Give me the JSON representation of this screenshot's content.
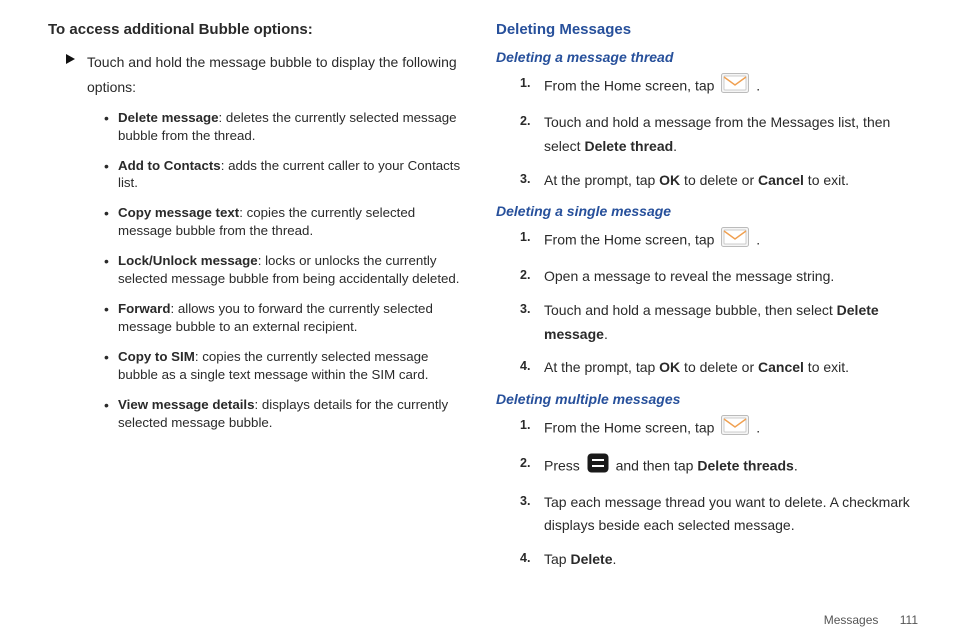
{
  "left": {
    "heading": "To access additional Bubble options:",
    "intro": "Touch and hold the message bubble to display the following options:",
    "bullets": [
      {
        "term": "Delete message",
        "desc": ": deletes the currently selected message bubble from the thread."
      },
      {
        "term": "Add to Contacts",
        "desc": ": adds the current caller to your Contacts list."
      },
      {
        "term": "Copy message text",
        "desc": ": copies the currently selected message bubble from the thread."
      },
      {
        "term": "Lock/Unlock message",
        "desc": ": locks or unlocks the currently selected message bubble from being accidentally deleted."
      },
      {
        "term": "Forward",
        "desc": ": allows you to forward the currently selected message bubble to an external recipient."
      },
      {
        "term": "Copy to SIM",
        "desc": ": copies the currently selected message bubble as a single text message within the SIM card."
      },
      {
        "term": "View message details",
        "desc": ": displays details for the currently selected message bubble."
      }
    ]
  },
  "right": {
    "heading": "Deleting Messages",
    "thread": {
      "title": "Deleting a message thread",
      "s1a": "From the Home screen, tap ",
      "s1b": ".",
      "s2a": "Touch and hold a message from the Messages list, then select ",
      "s2b": "Delete thread",
      "s2c": ".",
      "s3a": "At the prompt, tap ",
      "s3b": "OK",
      "s3c": " to delete or ",
      "s3d": "Cancel",
      "s3e": " to exit."
    },
    "single": {
      "title": "Deleting a single message",
      "s1a": "From the Home screen, tap ",
      "s1b": ".",
      "s2": "Open a message to reveal the message string.",
      "s3a": "Touch and hold a message bubble, then select ",
      "s3b": "Delete message",
      "s3c": ".",
      "s4a": "At the prompt, tap ",
      "s4b": "OK",
      "s4c": " to delete or ",
      "s4d": "Cancel",
      "s4e": " to exit."
    },
    "multiple": {
      "title": "Deleting multiple messages",
      "s1a": "From the Home screen, tap ",
      "s1b": ".",
      "s2a": "Press ",
      "s2b": " and then tap ",
      "s2c": "Delete threads",
      "s2d": ".",
      "s3": "Tap each message thread you want to delete. A checkmark displays beside each selected message.",
      "s4a": "Tap ",
      "s4b": "Delete",
      "s4c": "."
    }
  },
  "footer": {
    "section": "Messages",
    "page": "111"
  },
  "icons": {
    "messages": "messages-icon",
    "menu": "menu-icon"
  }
}
